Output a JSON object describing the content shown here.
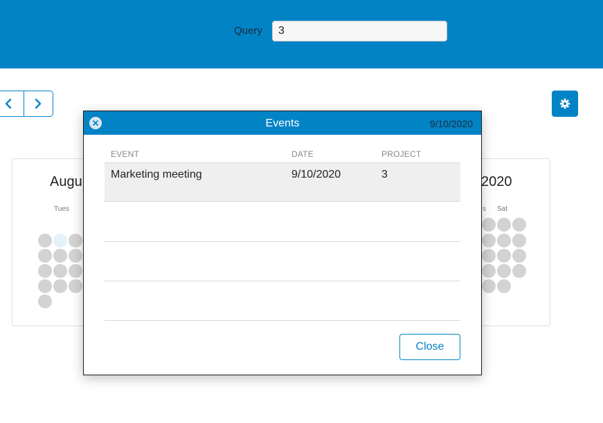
{
  "header": {
    "query_label": "Query",
    "query_value": "3"
  },
  "nav": {
    "prev_icon": "chevron-left-icon",
    "next_icon": "chevron-right-icon",
    "settings_icon": "gear-icon"
  },
  "calendar_left": {
    "month_title": "Augu",
    "weekday_label": "Tues"
  },
  "calendar_right": {
    "month_title": "2020",
    "weekday_partial": "s",
    "weekday_label": "Sat"
  },
  "modal": {
    "title": "Events",
    "date": "9/10/2020",
    "close_icon": "close-circle-icon",
    "columns": [
      "EVENT",
      "DATE",
      "PROJECT"
    ],
    "rows": [
      {
        "event": "Marketing meeting",
        "date": "9/10/2020",
        "project": "3"
      }
    ],
    "close_label": "Close"
  },
  "colors": {
    "accent": "#0283c6",
    "dot": "#d3d3d3",
    "dot_today": "#e4f2fa",
    "selected_row": "#efefef"
  }
}
